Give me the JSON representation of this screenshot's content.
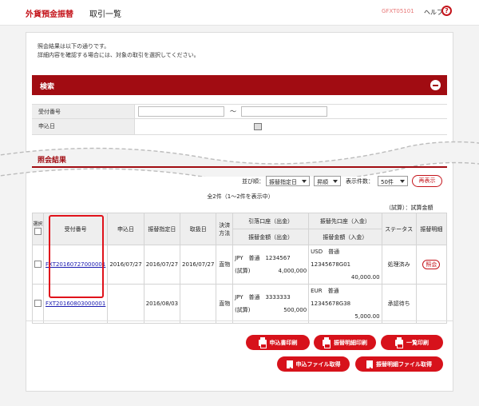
{
  "header": {
    "app_title": "外貨預金振替",
    "page_title": "取引一覧",
    "screen_id": "GFXT05101",
    "help_label": "ヘルプ",
    "help_icon": "question-circle-icon"
  },
  "intro": {
    "line1": "照会結果は以下の通りです。",
    "line2": "詳細内容を確認する場合には、対象の取引を選択してください。"
  },
  "search": {
    "title": "検索",
    "receipt_label": "受付番号",
    "range_sep": "～",
    "apply_date_label": "申込日"
  },
  "results": {
    "title": "照会結果",
    "sort_label": "並び順：",
    "sort_value": "振替指定日",
    "order_value": "昇順",
    "count_label": "表示件数：",
    "count_value": "50件",
    "redisplay_label": "再表示",
    "total_text": "全2件（1～2件を表示中）",
    "test_total": "（試算）：試算金額",
    "columns": {
      "select": "選択",
      "receipt_no": "受付番号",
      "apply_date": "申込日",
      "transfer_date": "振替指定日",
      "cancel_date": "取扱日",
      "settle_method": "決済方法",
      "source_account": "引落口座（出金）",
      "source_amount": "振替金額（出金）",
      "dest_account": "振替先口座（入金）",
      "dest_amount": "振替金額（入金）",
      "status": "ステータス",
      "detail": "振替明細"
    },
    "rows": [
      {
        "receipt_no": "FXT20160727000001",
        "apply_date": "2016/07/27",
        "transfer_date": "2016/07/27",
        "cancel_date": "2016/07/27",
        "settle_method": "直物",
        "src_account": "JPY　普通　1234567",
        "src_prefix": "(試算)",
        "src_amount": "4,000,000",
        "dst_account": "USD　普通　12345678G01",
        "dst_amount": "40,000.00",
        "status": "処理済み",
        "detail_label": "照会"
      },
      {
        "receipt_no": "FXT20160803000001",
        "apply_date": "",
        "transfer_date": "2016/08/03",
        "cancel_date": "",
        "settle_method": "直物",
        "src_account": "JPY　普通　3333333",
        "src_prefix": "(試算)",
        "src_amount": "500,000",
        "dst_account": "EUR　普通　12345678G38",
        "dst_amount": "5,000.00",
        "status": "承認待ち",
        "detail_label": ""
      }
    ]
  },
  "actions": {
    "print_application": "申込書印刷",
    "print_detail": "振替明細印刷",
    "print_list": "一覧印刷",
    "get_application_file": "申込ファイル取得",
    "get_detail_file": "振替明細ファイル取得"
  }
}
